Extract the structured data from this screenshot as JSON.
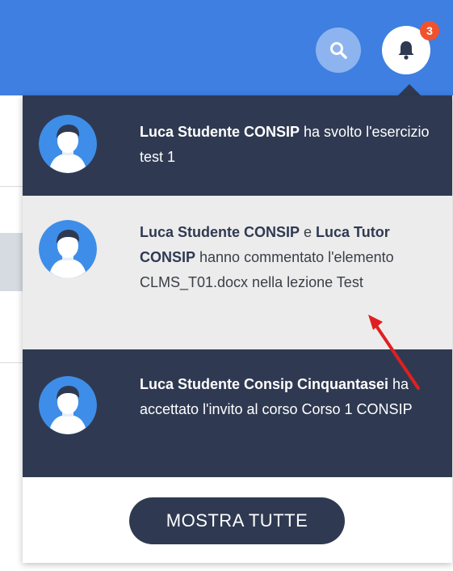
{
  "header": {
    "search_icon": "search-icon",
    "bell_icon": "bell-icon",
    "badge_count": "3"
  },
  "notifications": [
    {
      "style": "dark",
      "parts": [
        {
          "t": "Luca Studente CONSIP",
          "b": true
        },
        {
          "t": " ha svolto l'esercizio test 1",
          "b": false
        }
      ]
    },
    {
      "style": "light",
      "parts": [
        {
          "t": "Luca Studente CONSIP",
          "b": true
        },
        {
          "t": " e ",
          "b": false
        },
        {
          "t": "Luca Tutor CONSIP",
          "b": true
        },
        {
          "t": " hanno commentato l'elemento CLMS_T01.docx nella lezione Test",
          "b": false
        }
      ]
    },
    {
      "style": "dark",
      "parts": [
        {
          "t": "Luca Studente Consip Cinquantasei",
          "b": true
        },
        {
          "t": " ha accettato l'invito al corso Corso 1 CONSIP",
          "b": false
        }
      ]
    }
  ],
  "footer": {
    "show_all_label": "MOSTRA TUTTE"
  },
  "colors": {
    "header_blue": "#3e7fe1",
    "dark_panel": "#2f3a52",
    "light_panel": "#ececec",
    "badge_red": "#f0522e",
    "avatar_blue": "#3e8ee9",
    "annotation_red": "#e02020"
  }
}
